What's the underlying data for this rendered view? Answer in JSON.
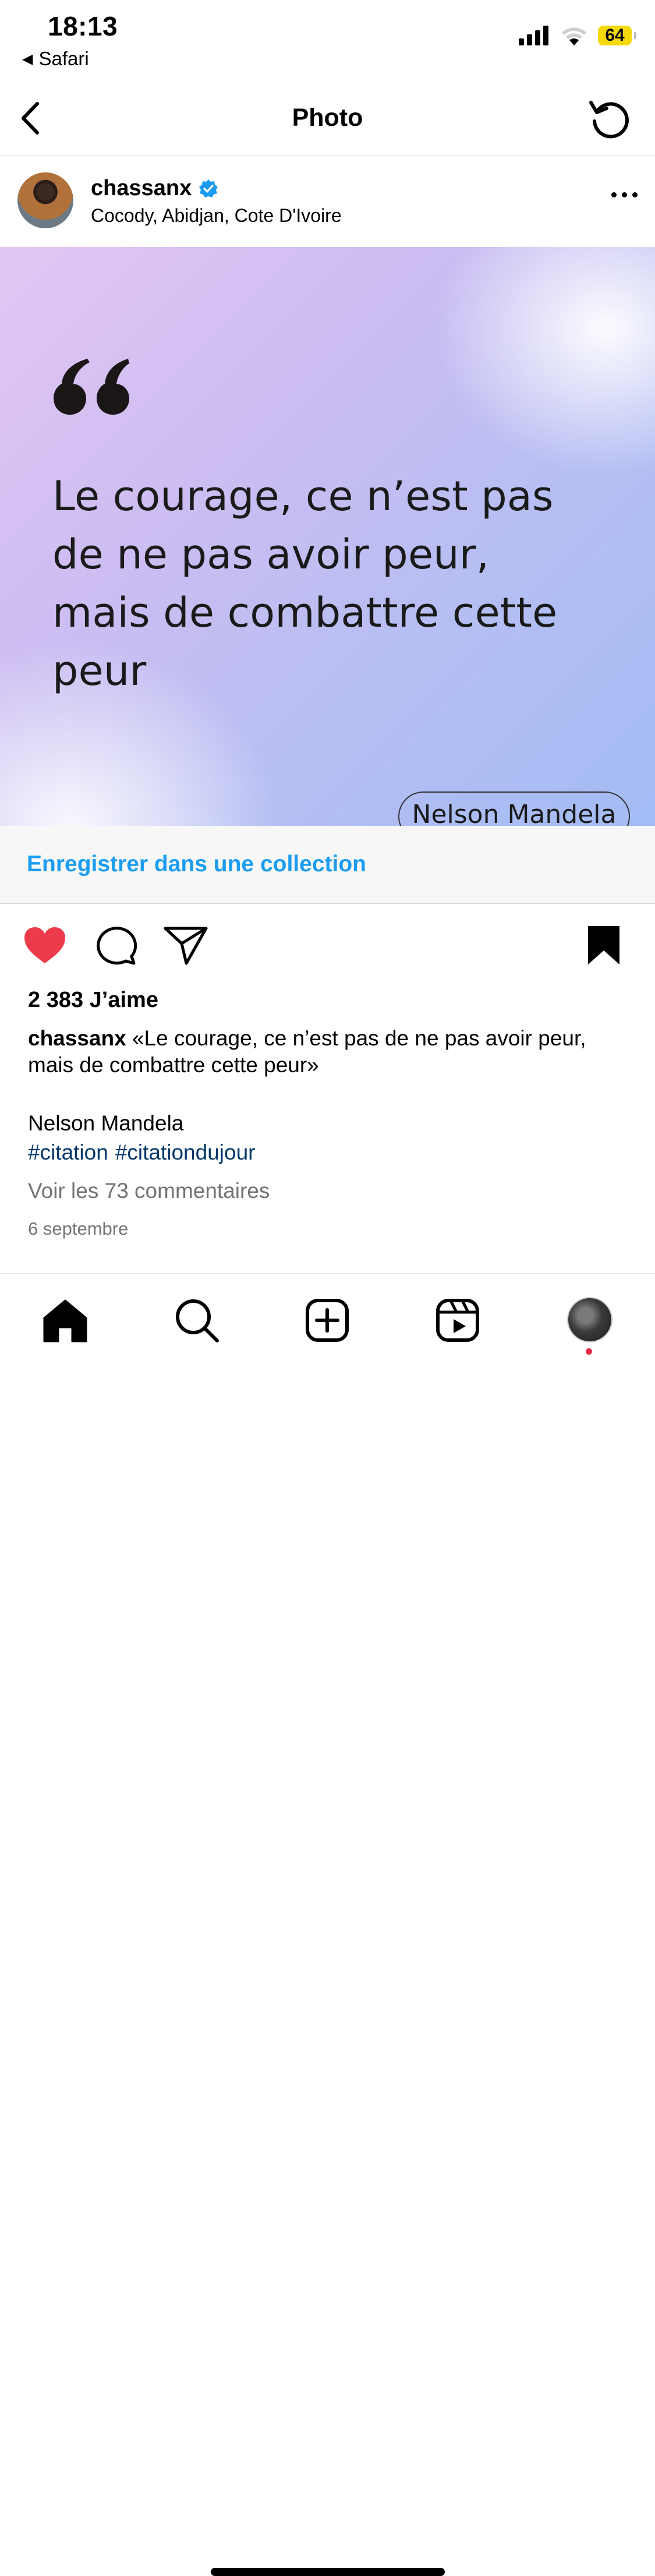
{
  "status_bar": {
    "time": "18:13",
    "back_app": "Safari",
    "battery": "64"
  },
  "nav": {
    "title": "Photo"
  },
  "post": {
    "username": "chassanx",
    "verified": true,
    "location": "Cocody, Abidjan, Cote D'Ivoire",
    "image": {
      "quote_lines": [
        "Le courage, ce n’est pas",
        "de ne pas avoir peur,",
        "mais de combattre cette",
        "peur"
      ],
      "author": "Nelson Mandela"
    },
    "save_collection_label": "Enregistrer dans une collection",
    "liked": true,
    "saved": true,
    "likes_text": "2 383 J’aime",
    "caption_username": "chassanx",
    "caption_text": "«Le courage, ce n’est pas de ne pas avoir peur, mais de combattre cette peur»",
    "caption_author": "Nelson Mandela",
    "hashtags": [
      "#citation",
      "#citationdujour"
    ],
    "comments_link": "Voir les 73 commentaires",
    "date": "6 septembre"
  },
  "colors": {
    "accent_blue": "#1b9cf0",
    "like_red": "#ed3b4b",
    "hashtag": "#00376b",
    "muted": "#737373"
  },
  "icons": {
    "nav": [
      "back-chevron-icon",
      "refresh-icon"
    ],
    "actions": [
      "heart-icon",
      "comment-icon",
      "share-icon",
      "bookmark-icon"
    ],
    "tabs": [
      "home-icon",
      "search-icon",
      "create-icon",
      "reels-icon",
      "profile-avatar"
    ]
  }
}
